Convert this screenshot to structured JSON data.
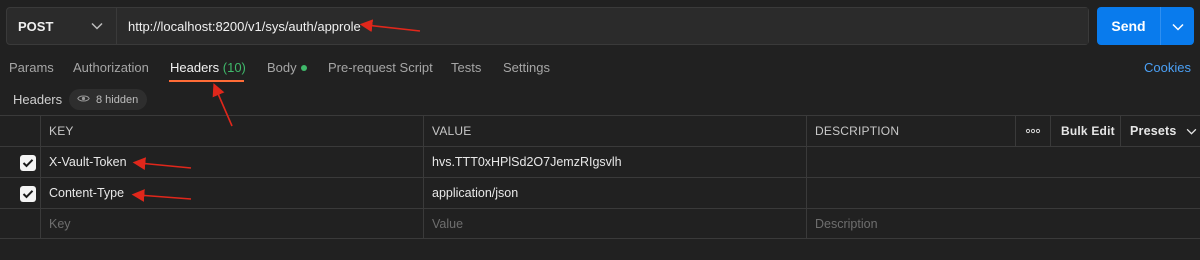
{
  "request": {
    "method": "POST",
    "url": "http://localhost:8200/v1/sys/auth/approle",
    "send_label": "Send"
  },
  "tabs": [
    {
      "label": "Params"
    },
    {
      "label": "Authorization"
    },
    {
      "label": "Headers",
      "count": "(10)"
    },
    {
      "label": "Body"
    },
    {
      "label": "Pre-request Script"
    },
    {
      "label": "Tests"
    },
    {
      "label": "Settings"
    }
  ],
  "cookies_label": "Cookies",
  "headers_section": {
    "title": "Headers",
    "hidden_label": "8 hidden"
  },
  "table": {
    "columns": [
      "KEY",
      "VALUE",
      "DESCRIPTION"
    ],
    "bulk_edit_label": "Bulk Edit",
    "presets_label": "Presets",
    "rows": [
      {
        "checked": true,
        "key": "X-Vault-Token",
        "value": "hvs.TTT0xHPlSd2O7JemzRIgsvlh",
        "description": ""
      },
      {
        "checked": true,
        "key": "Content-Type",
        "value": "application/json",
        "description": ""
      }
    ],
    "placeholder": {
      "key": "Key",
      "value": "Value",
      "description": "Description"
    }
  },
  "colors": {
    "accent_tab": "#ff6c37",
    "send_button": "#097bed",
    "count_green": "#3fb96a",
    "link_blue": "#4ba0f5",
    "annotation_red": "#e0271b"
  }
}
